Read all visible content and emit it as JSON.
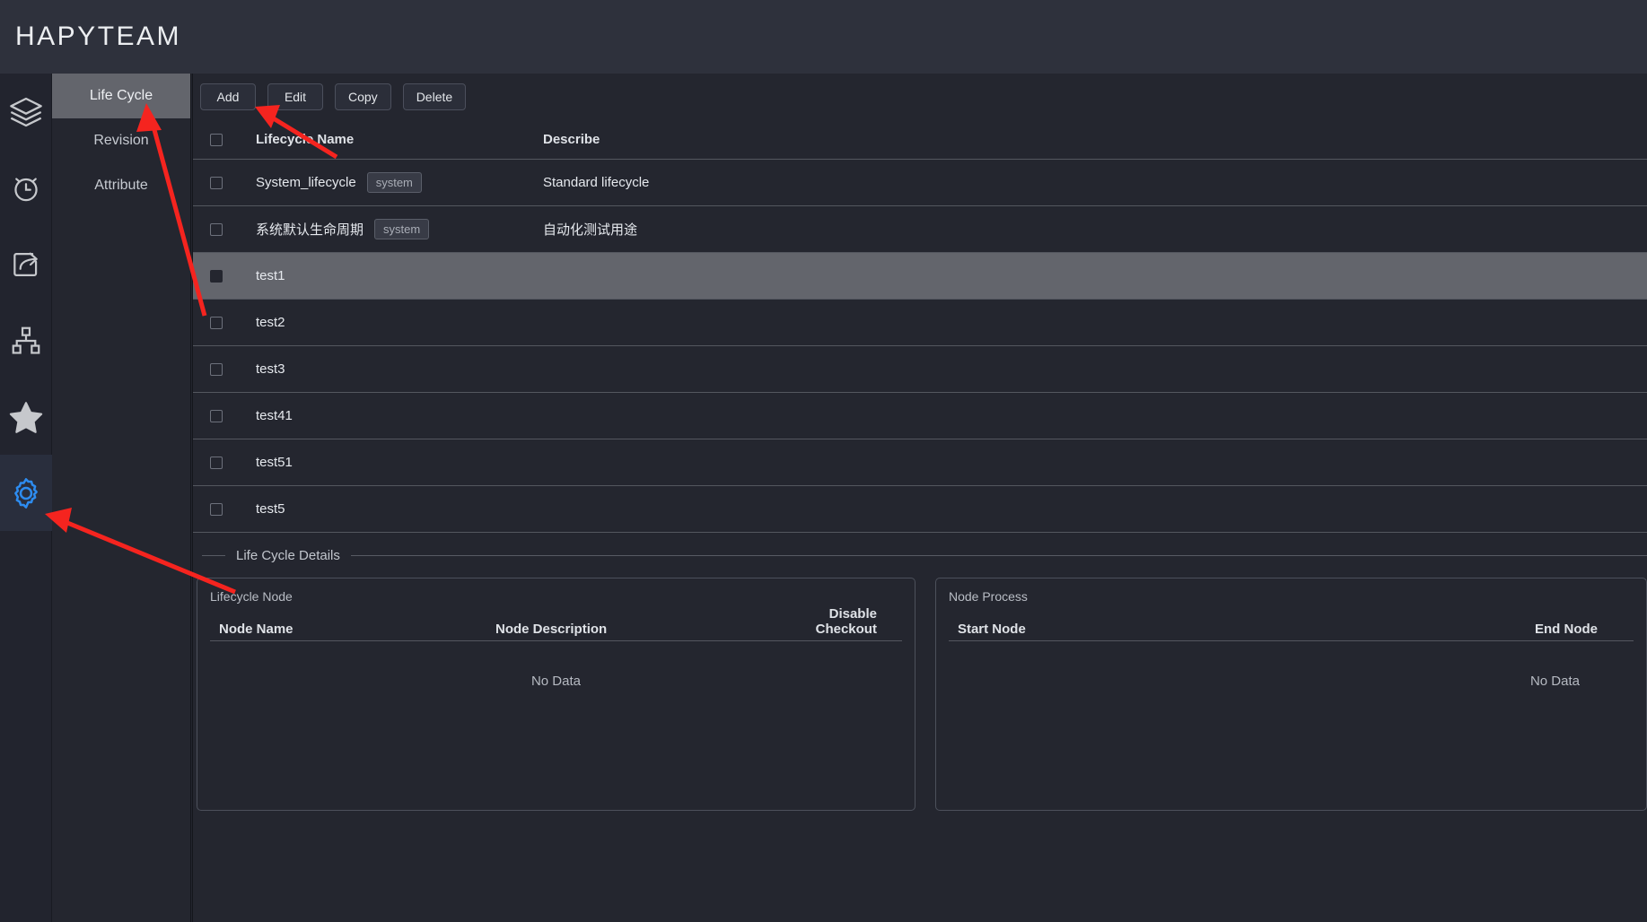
{
  "app": {
    "brand": "HAPYTEAM"
  },
  "rail": {
    "items": [
      {
        "icon": "layers-icon",
        "active": false
      },
      {
        "icon": "clock-icon",
        "active": false
      },
      {
        "icon": "share-icon",
        "active": false
      },
      {
        "icon": "sitemap-icon",
        "active": false
      },
      {
        "icon": "star-icon",
        "active": false
      },
      {
        "icon": "gear-icon",
        "active": true
      }
    ],
    "active_color": "#2d8cf0",
    "inactive_color": "#c6c8cc"
  },
  "submenu": {
    "items": [
      {
        "label": "Life Cycle",
        "active": true
      },
      {
        "label": "Revision",
        "active": false
      },
      {
        "label": "Attribute",
        "active": false
      }
    ]
  },
  "toolbar": {
    "buttons": [
      {
        "label": "Add"
      },
      {
        "label": "Edit"
      },
      {
        "label": "Copy"
      },
      {
        "label": "Delete"
      }
    ]
  },
  "table": {
    "headers": {
      "name": "Lifecycle Name",
      "describe": "Describe"
    },
    "rows": [
      {
        "name": "System_lifecycle",
        "tag": "system",
        "describe": "Standard lifecycle",
        "checked": false,
        "selected": false
      },
      {
        "name": "系统默认生命周期",
        "tag": "system",
        "describe": "自动化测试用途",
        "checked": false,
        "selected": false
      },
      {
        "name": "test1",
        "tag": "",
        "describe": "",
        "checked": true,
        "selected": true
      },
      {
        "name": "test2",
        "tag": "",
        "describe": "",
        "checked": false,
        "selected": false
      },
      {
        "name": "test3",
        "tag": "",
        "describe": "",
        "checked": false,
        "selected": false
      },
      {
        "name": "test41",
        "tag": "",
        "describe": "",
        "checked": false,
        "selected": false
      },
      {
        "name": "test51",
        "tag": "",
        "describe": "",
        "checked": false,
        "selected": false
      },
      {
        "name": "test5",
        "tag": "",
        "describe": "",
        "checked": false,
        "selected": false
      }
    ]
  },
  "details": {
    "divider_title": "Life Cycle Details",
    "lifecycle_node": {
      "panel_title": "Lifecycle Node",
      "col_node_name": "Node Name",
      "col_node_description": "Node Description",
      "col_disable_checkout": "Disable Checkout",
      "empty_text": "No Data"
    },
    "node_process": {
      "panel_title": "Node Process",
      "col_start_node": "Start Node",
      "col_end_node": "End Node",
      "empty_text": "No Data"
    }
  },
  "annotations": {
    "arrow_color": "#f5241f",
    "arrows": [
      {
        "name": "arrow-to-life-cycle",
        "target": "Life Cycle menu item"
      },
      {
        "name": "arrow-to-add-button",
        "target": "Add button"
      },
      {
        "name": "arrow-to-gear-icon",
        "target": "Settings gear icon"
      }
    ]
  }
}
